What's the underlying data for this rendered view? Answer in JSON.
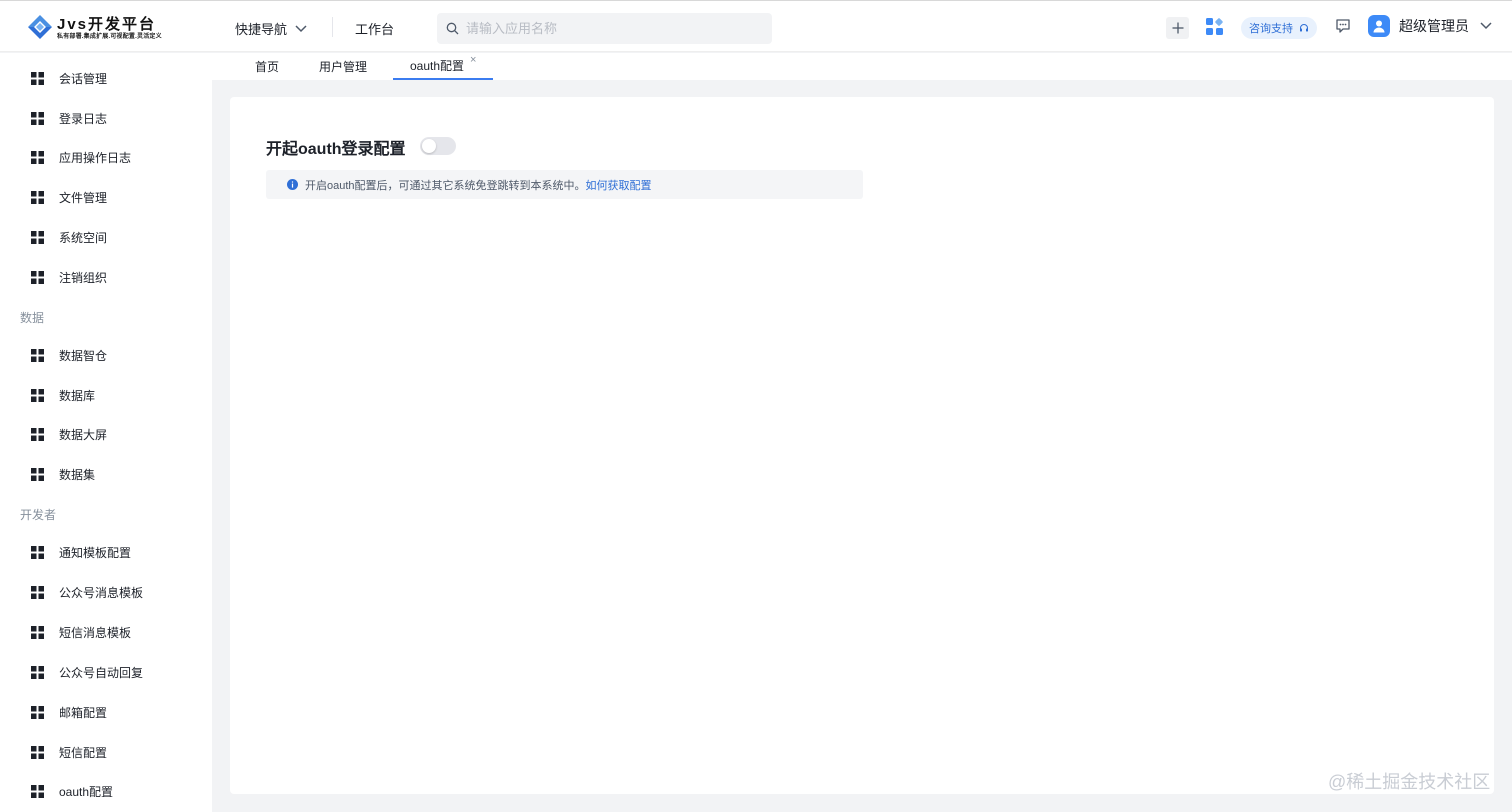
{
  "header": {
    "brand_title": "Jvs开发平台",
    "brand_subtitle": "私有部署.集成扩展.可视配置.灵活定义",
    "quick_nav": "快捷导航",
    "workbench": "工作台",
    "search_placeholder": "请输入应用名称",
    "support": "咨询支持",
    "user_name": "超级管理员"
  },
  "sidebar": {
    "items_top": [
      {
        "label": "会话管理"
      },
      {
        "label": "登录日志"
      },
      {
        "label": "应用操作日志"
      },
      {
        "label": "文件管理"
      },
      {
        "label": "系统空间"
      },
      {
        "label": "注销组织"
      }
    ],
    "group_data": "数据",
    "items_data": [
      {
        "label": "数据智仓"
      },
      {
        "label": "数据库"
      },
      {
        "label": "数据大屏"
      },
      {
        "label": "数据集"
      }
    ],
    "group_dev": "开发者",
    "items_dev": [
      {
        "label": "通知模板配置"
      },
      {
        "label": "公众号消息模板"
      },
      {
        "label": "短信消息模板"
      },
      {
        "label": "公众号自动回复"
      },
      {
        "label": "邮箱配置"
      },
      {
        "label": "短信配置"
      },
      {
        "label": "oauth配置"
      }
    ]
  },
  "tabs": [
    {
      "label": "首页"
    },
    {
      "label": "用户管理"
    },
    {
      "label": "oauth配置",
      "close": "×"
    }
  ],
  "main": {
    "title": "开起oauth登录配置",
    "toggle_on": false,
    "tip_text": "开启oauth配置后，可通过其它系统免登跳转到本系统中。",
    "tip_link": "如何获取配置"
  },
  "watermark": "@稀土掘金技术社区",
  "colors": {
    "accent": "#3b7cf0",
    "link": "#2f6fd6",
    "page_bg": "#f2f3f5"
  }
}
